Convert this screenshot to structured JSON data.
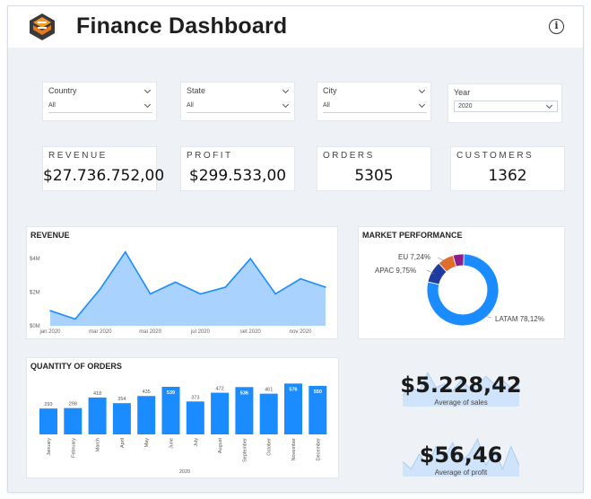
{
  "header": {
    "title": "Finance Dashboard"
  },
  "filters": [
    {
      "label": "Country",
      "value": "All"
    },
    {
      "label": "State",
      "value": "All"
    },
    {
      "label": "City",
      "value": "All"
    },
    {
      "label": "Year",
      "value": "2020"
    }
  ],
  "kpis": [
    {
      "label": "REVENUE",
      "value": "$27.736.752,00"
    },
    {
      "label": "PROFIT",
      "value": "$299.533,00"
    },
    {
      "label": "ORDERS",
      "value": "5305"
    },
    {
      "label": "CUSTOMERS",
      "value": "1362"
    }
  ],
  "revenue_panel": {
    "title": "REVENUE"
  },
  "market_panel": {
    "title": "MARKET PERFORMANCE"
  },
  "orders_panel": {
    "title": "QUANTITY OF ORDERS"
  },
  "avg_sales": {
    "value": "$5.228,42",
    "label": "Average of sales"
  },
  "avg_profit": {
    "value": "$56,46",
    "label": "Average of profit"
  },
  "colors": {
    "accent": "#1a8cff",
    "area_fill": "#a9d2ff",
    "apac": "#1f3ca0",
    "eu": "#e06c2d",
    "other": "#8a1e8c"
  },
  "chart_data": [
    {
      "type": "area",
      "title": "REVENUE",
      "x_ticks": [
        "jan 2020",
        "mar 2020",
        "mai 2020",
        "jul 2020",
        "set 2020",
        "nov 2020"
      ],
      "y_ticks": [
        "$0M",
        "$2M",
        "$4M"
      ],
      "ylim": [
        0,
        4.6
      ],
      "values": [
        0.9,
        0.4,
        2.2,
        4.4,
        1.9,
        2.6,
        1.9,
        2.3,
        4.0,
        1.9,
        2.8,
        2.3
      ],
      "grid": false
    },
    {
      "type": "pie",
      "title": "MARKET PERFORMANCE",
      "slices": [
        {
          "label": "LATAM 78,12%",
          "value": 78.12,
          "color": "#1a8cff"
        },
        {
          "label": "APAC 9,75%",
          "value": 9.75,
          "color": "#1f3ca0"
        },
        {
          "label": "EU 7,24%",
          "value": 7.24,
          "color": "#e06c2d"
        },
        {
          "label": "",
          "value": 4.89,
          "color": "#8a1e8c"
        }
      ]
    },
    {
      "type": "bar",
      "title": "QUANTITY OF ORDERS",
      "xlabel": "2020",
      "categories": [
        "January",
        "February",
        "March",
        "April",
        "May",
        "June",
        "July",
        "August",
        "September",
        "October",
        "November",
        "December"
      ],
      "values": [
        293,
        298,
        418,
        354,
        435,
        539,
        373,
        472,
        536,
        461,
        576,
        550
      ],
      "ylim": [
        0,
        600
      ]
    },
    {
      "type": "area",
      "title": "Average of sales",
      "values": [
        3,
        5,
        4,
        9,
        5,
        6,
        4,
        7,
        5,
        6,
        8,
        6,
        7,
        5,
        6
      ],
      "ylim": [
        0,
        10
      ]
    },
    {
      "type": "area",
      "title": "Average of profit",
      "values": [
        4,
        2,
        6,
        3,
        8,
        5,
        9,
        4,
        6,
        10,
        3,
        7,
        2,
        8,
        3
      ],
      "ylim": [
        0,
        11
      ]
    }
  ]
}
